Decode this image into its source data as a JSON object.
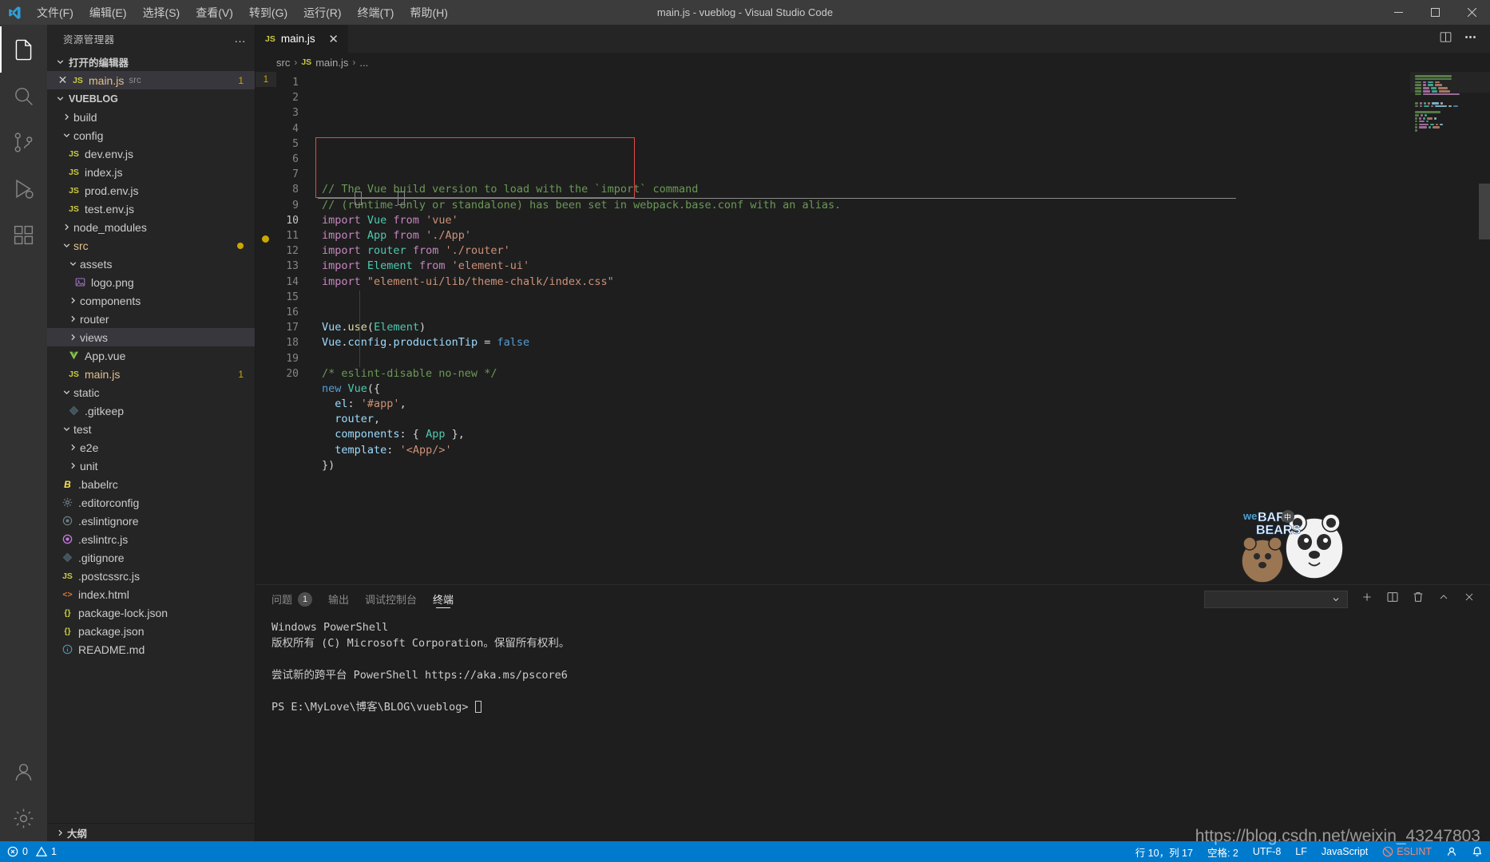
{
  "titlebar": {
    "window_title": "main.js - vueblog - Visual Studio Code",
    "menu": [
      "文件(F)",
      "编辑(E)",
      "选择(S)",
      "查看(V)",
      "转到(G)",
      "运行(R)",
      "终端(T)",
      "帮助(H)"
    ],
    "controls": {
      "minimize": "—",
      "maximize": "▢",
      "close": "✕"
    }
  },
  "activitybar": {
    "items": [
      {
        "name": "explorer",
        "icon": "files-icon"
      },
      {
        "name": "search",
        "icon": "search-icon"
      },
      {
        "name": "source-control",
        "icon": "source-control-icon"
      },
      {
        "name": "run-debug",
        "icon": "run-debug-icon"
      },
      {
        "name": "extensions",
        "icon": "extensions-icon"
      }
    ],
    "bottom": [
      {
        "name": "accounts",
        "icon": "account-icon"
      },
      {
        "name": "settings",
        "icon": "gear-icon"
      }
    ]
  },
  "sidebar": {
    "title": "资源管理器",
    "more_label": "…",
    "open_editors": {
      "title": "打开的编辑器",
      "items": [
        {
          "close": "✕",
          "icon": "js-icon",
          "name": "main.js",
          "folder": "src",
          "badge": "1"
        }
      ]
    },
    "project": {
      "title": "VUEBLOG",
      "tree": [
        {
          "label": "build",
          "type": "folder",
          "collapsed": true,
          "indent": 1
        },
        {
          "label": "config",
          "type": "folder",
          "collapsed": false,
          "indent": 1
        },
        {
          "label": "dev.env.js",
          "type": "js",
          "indent": 2
        },
        {
          "label": "index.js",
          "type": "js",
          "indent": 2
        },
        {
          "label": "prod.env.js",
          "type": "js",
          "indent": 2
        },
        {
          "label": "test.env.js",
          "type": "js",
          "indent": 2
        },
        {
          "label": "node_modules",
          "type": "folder",
          "collapsed": true,
          "indent": 1
        },
        {
          "label": "src",
          "type": "folder",
          "collapsed": false,
          "indent": 1,
          "modified": true,
          "accent": true
        },
        {
          "label": "assets",
          "type": "folder",
          "collapsed": false,
          "indent": 2
        },
        {
          "label": "logo.png",
          "type": "png",
          "indent": 3
        },
        {
          "label": "components",
          "type": "folder",
          "collapsed": true,
          "indent": 2
        },
        {
          "label": "router",
          "type": "folder",
          "collapsed": true,
          "indent": 2
        },
        {
          "label": "views",
          "type": "folder",
          "collapsed": true,
          "indent": 2,
          "selected": true
        },
        {
          "label": "App.vue",
          "type": "vue",
          "indent": 2
        },
        {
          "label": "main.js",
          "type": "js",
          "indent": 2,
          "badge": "1",
          "accent": true
        },
        {
          "label": "static",
          "type": "folder",
          "collapsed": false,
          "indent": 1
        },
        {
          "label": ".gitkeep",
          "type": "git",
          "indent": 2
        },
        {
          "label": "test",
          "type": "folder",
          "collapsed": false,
          "indent": 1
        },
        {
          "label": "e2e",
          "type": "folder",
          "collapsed": true,
          "indent": 2
        },
        {
          "label": "unit",
          "type": "folder",
          "collapsed": true,
          "indent": 2
        },
        {
          "label": ".babelrc",
          "type": "babel",
          "indent": 1
        },
        {
          "label": ".editorconfig",
          "type": "cfg",
          "indent": 1
        },
        {
          "label": ".eslintignore",
          "type": "eslintgray",
          "indent": 1
        },
        {
          "label": ".eslintrc.js",
          "type": "eslint",
          "indent": 1
        },
        {
          "label": ".gitignore",
          "type": "git",
          "indent": 1
        },
        {
          "label": ".postcssrc.js",
          "type": "js",
          "indent": 1
        },
        {
          "label": "index.html",
          "type": "html",
          "indent": 1
        },
        {
          "label": "package-lock.json",
          "type": "json",
          "indent": 1
        },
        {
          "label": "package.json",
          "type": "json",
          "indent": 1
        },
        {
          "label": "README.md",
          "type": "md",
          "indent": 1
        }
      ]
    },
    "outline": "大纲"
  },
  "editor": {
    "tabs": [
      {
        "icon": "js-icon",
        "label": "main.js",
        "close": "✕",
        "active": true
      }
    ],
    "tab_actions": [
      "split-editor-icon",
      "more-actions-icon"
    ],
    "breadcrumb": [
      "src",
      "main.js",
      "..."
    ],
    "breadcrumb_file_icon": "js-icon",
    "error_marker_line": "1",
    "lines": [
      {
        "n": 1,
        "tokens": [
          {
            "t": "// The Vue build version to load with the `import` command",
            "c": "t-comment"
          }
        ]
      },
      {
        "n": 2,
        "tokens": [
          {
            "t": "// (runtime-only or standalone) has been set in webpack.base.conf with an alias.",
            "c": "t-comment"
          }
        ]
      },
      {
        "n": 3,
        "tokens": [
          {
            "t": "import ",
            "c": "t-kw"
          },
          {
            "t": "Vue",
            "c": "t-cls"
          },
          {
            "t": " from ",
            "c": "t-kw"
          },
          {
            "t": "'vue'",
            "c": "t-str"
          }
        ]
      },
      {
        "n": 4,
        "tokens": [
          {
            "t": "import ",
            "c": "t-kw"
          },
          {
            "t": "App",
            "c": "t-cls"
          },
          {
            "t": " from ",
            "c": "t-kw"
          },
          {
            "t": "'./App'",
            "c": "t-str"
          }
        ]
      },
      {
        "n": 5,
        "tokens": [
          {
            "t": "import ",
            "c": "t-kw"
          },
          {
            "t": "router",
            "c": "t-cls"
          },
          {
            "t": " from ",
            "c": "t-kw"
          },
          {
            "t": "'./router'",
            "c": "t-str"
          }
        ]
      },
      {
        "n": 6,
        "tokens": [
          {
            "t": "import ",
            "c": "t-kw"
          },
          {
            "t": "Element",
            "c": "t-cls"
          },
          {
            "t": " from ",
            "c": "t-kw"
          },
          {
            "t": "'element-ui'",
            "c": "t-str"
          }
        ]
      },
      {
        "n": 7,
        "tokens": [
          {
            "t": "import ",
            "c": "t-kw"
          },
          {
            "t": "\"element-ui/lib/theme-chalk/index.css\"",
            "c": "t-str"
          }
        ]
      },
      {
        "n": 8,
        "tokens": []
      },
      {
        "n": 9,
        "tokens": []
      },
      {
        "n": 10,
        "tokens": [
          {
            "t": "Vue",
            "c": "t-var"
          },
          {
            "t": ".",
            "c": "t-plain"
          },
          {
            "t": "use",
            "c": "t-fn"
          },
          {
            "t": "(",
            "c": "t-plain"
          },
          {
            "t": "Element",
            "c": "t-cls"
          },
          {
            "t": ")",
            "c": "t-plain"
          }
        ]
      },
      {
        "n": 11,
        "tokens": [
          {
            "t": "Vue",
            "c": "t-var"
          },
          {
            "t": ".",
            "c": "t-plain"
          },
          {
            "t": "config",
            "c": "t-prop"
          },
          {
            "t": ".",
            "c": "t-plain"
          },
          {
            "t": "productionTip",
            "c": "t-prop"
          },
          {
            "t": " = ",
            "c": "t-plain"
          },
          {
            "t": "false",
            "c": "t-kw2"
          }
        ]
      },
      {
        "n": 12,
        "tokens": []
      },
      {
        "n": 13,
        "tokens": [
          {
            "t": "/* eslint-disable no-new */",
            "c": "t-comment"
          }
        ]
      },
      {
        "n": 14,
        "tokens": [
          {
            "t": "new ",
            "c": "t-kw2"
          },
          {
            "t": "Vue",
            "c": "t-cls"
          },
          {
            "t": "({",
            "c": "t-plain"
          }
        ]
      },
      {
        "n": 15,
        "tokens": [
          {
            "t": "  ",
            "c": "t-plain"
          },
          {
            "t": "el",
            "c": "t-var"
          },
          {
            "t": ": ",
            "c": "t-plain"
          },
          {
            "t": "'#app'",
            "c": "t-str"
          },
          {
            "t": ",",
            "c": "t-plain"
          }
        ]
      },
      {
        "n": 16,
        "tokens": [
          {
            "t": "  ",
            "c": "t-plain"
          },
          {
            "t": "router",
            "c": "t-var"
          },
          {
            "t": ",",
            "c": "t-plain"
          }
        ]
      },
      {
        "n": 17,
        "tokens": [
          {
            "t": "  ",
            "c": "t-plain"
          },
          {
            "t": "components",
            "c": "t-var"
          },
          {
            "t": ": { ",
            "c": "t-plain"
          },
          {
            "t": "App",
            "c": "t-cls"
          },
          {
            "t": " },",
            "c": "t-plain"
          }
        ]
      },
      {
        "n": 18,
        "tokens": [
          {
            "t": "  ",
            "c": "t-plain"
          },
          {
            "t": "template",
            "c": "t-var"
          },
          {
            "t": ": ",
            "c": "t-plain"
          },
          {
            "t": "'<App/>'",
            "c": "t-str"
          }
        ]
      },
      {
        "n": 19,
        "tokens": [
          {
            "t": "})",
            "c": "t-plain"
          }
        ]
      },
      {
        "n": 20,
        "tokens": []
      }
    ],
    "annotation": {
      "type": "red-rectangle",
      "color": "#e24a4a",
      "covers_lines": "6-10"
    }
  },
  "panel": {
    "tabs": [
      {
        "label": "问题",
        "badge": "1",
        "active": false
      },
      {
        "label": "输出",
        "active": false
      },
      {
        "label": "调试控制台",
        "active": false
      },
      {
        "label": "终端",
        "active": true
      }
    ],
    "terminal_select_value": "",
    "actions": [
      "add-terminal-icon",
      "split-terminal-icon",
      "kill-terminal-icon",
      "chevron-up-icon",
      "close-icon"
    ],
    "terminal_lines": [
      "Windows PowerShell",
      "版权所有 (C) Microsoft Corporation。保留所有权利。",
      "",
      "尝试新的跨平台 PowerShell https://aka.ms/pscore6",
      "",
      "PS E:\\MyLove\\博客\\BLOG\\vueblog> "
    ]
  },
  "statusbar": {
    "left": [
      {
        "icon": "error-icon",
        "label": "0"
      },
      {
        "icon": "warning-icon",
        "label": "1"
      }
    ],
    "right": [
      {
        "label": "行 10，列 17"
      },
      {
        "label": "空格: 2"
      },
      {
        "label": "UTF-8"
      },
      {
        "label": "LF"
      },
      {
        "label": "JavaScript"
      },
      {
        "label": "ESLINT",
        "icon": "eslint-blocked-icon",
        "color": "#f48771"
      },
      {
        "icon": "account-icon",
        "label": ""
      },
      {
        "icon": "bell-icon",
        "label": ""
      }
    ]
  },
  "watermark": "https://blog.csdn.net/weixin_43247803",
  "sticker": {
    "text_top": "WE BARE",
    "text_bottom": "BEARS"
  },
  "colors": {
    "accent": "#007acc",
    "annotation": "#e24a4a",
    "modified": "#cca700",
    "editor_bg": "#1e1e1e",
    "sidebar_bg": "#252526"
  }
}
